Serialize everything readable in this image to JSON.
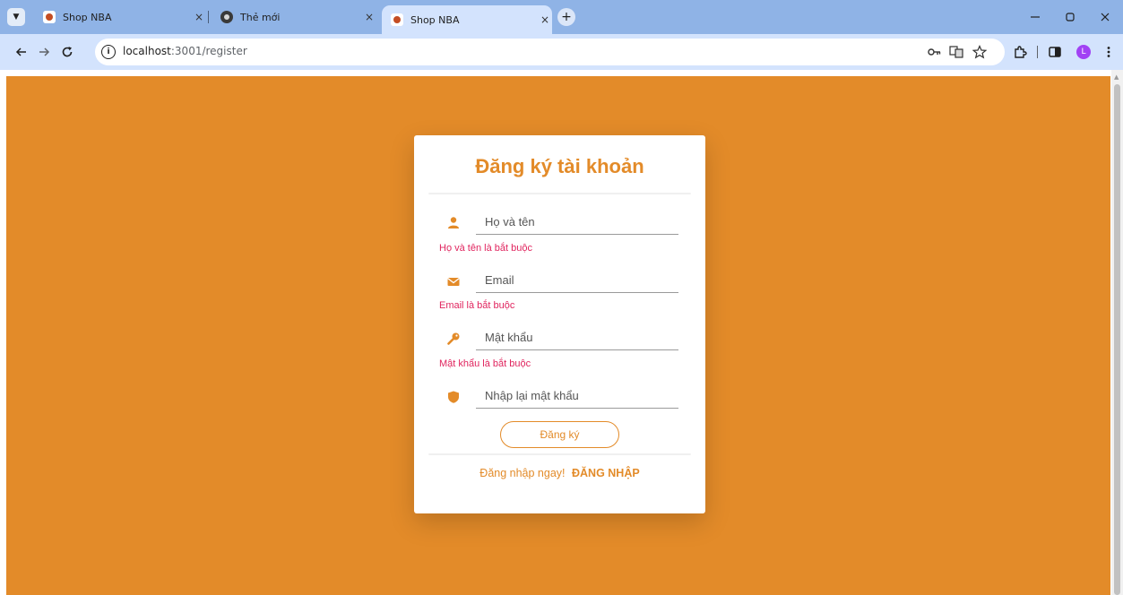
{
  "browser": {
    "tabs": [
      {
        "title": "Shop NBA",
        "active": false
      },
      {
        "title": "Thẻ mới",
        "active": false
      },
      {
        "title": "Shop NBA",
        "active": true
      }
    ],
    "url_host": "localhost",
    "url_path": ":3001/register",
    "profile_initial": "L",
    "close_glyph": "×",
    "new_tab_glyph": "+",
    "icons": {
      "tab_search": "chevron-down-icon",
      "back": "arrow-left-icon",
      "forward": "arrow-right-icon",
      "reload": "reload-icon",
      "site_info": "info-icon",
      "password_key": "key-icon",
      "translate": "translate-icon",
      "bookmark": "star-icon",
      "extensions": "puzzle-icon",
      "side_panel": "side-panel-icon",
      "menu": "kebab-menu-icon"
    },
    "colors": {
      "tabstrip": "#8fb3e6",
      "toolbar": "#d3e3fd",
      "profile": "#a142f4"
    }
  },
  "register": {
    "title": "Đăng ký tài khoản",
    "fields": [
      {
        "placeholder": "Họ và tên",
        "value": "",
        "error": "Họ và tên là bắt buộc",
        "icon": "user-icon"
      },
      {
        "placeholder": "Email",
        "value": "",
        "error": "Email là bắt buộc",
        "icon": "envelope-icon"
      },
      {
        "placeholder": "Mật khẩu",
        "value": "",
        "error": "Mật khẩu là bắt buộc",
        "icon": "key-icon"
      },
      {
        "placeholder": "Nhập lại mật khẩu",
        "value": "",
        "error": "",
        "icon": "shield-icon"
      }
    ],
    "submit_label": "Đăng ký",
    "login_prompt": "Đăng nhập ngay!",
    "login_link": "ĐĂNG NHẬP"
  },
  "theme": {
    "page_background": "#e38b29",
    "accent": "#e38b29",
    "error": "#e0245e",
    "card_background": "#ffffff"
  }
}
